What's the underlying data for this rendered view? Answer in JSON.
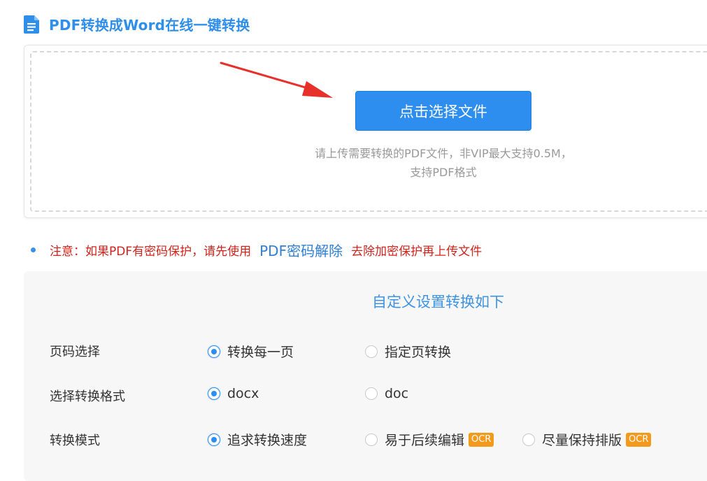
{
  "header": {
    "title": "PDF转换成Word在线一键转换",
    "icon": "document-icon"
  },
  "upload": {
    "button_label": "点击选择文件",
    "hint_line1": "请上传需要转换的PDF文件，非VIP最大支持0.5M，",
    "hint_line2": "支持PDF格式"
  },
  "notice": {
    "prefix": "注意：如果PDF有密码保护，请先使用",
    "link": "PDF密码解除",
    "suffix": "去除加密保护再上传文件"
  },
  "settings": {
    "heading": "自定义设置转换如下",
    "rows": [
      {
        "label": "页码选择",
        "options": [
          {
            "label": "转换每一页",
            "checked": true
          },
          {
            "label": "指定页转换",
            "checked": false
          }
        ]
      },
      {
        "label": "选择转换格式",
        "options": [
          {
            "label": "docx",
            "checked": true
          },
          {
            "label": "doc",
            "checked": false
          }
        ]
      },
      {
        "label": "转换模式",
        "options": [
          {
            "label": "追求转换速度",
            "checked": true
          },
          {
            "label": "易于后续编辑",
            "checked": false,
            "badge": "OCR"
          },
          {
            "label": "尽量保持排版",
            "checked": false,
            "badge": "OCR"
          }
        ]
      }
    ]
  },
  "colors": {
    "accent": "#2e8ef0",
    "title": "#2f8ee9",
    "notice_red": "#d0231b",
    "badge": "#f39a1d",
    "arrow": "#e8302a"
  }
}
